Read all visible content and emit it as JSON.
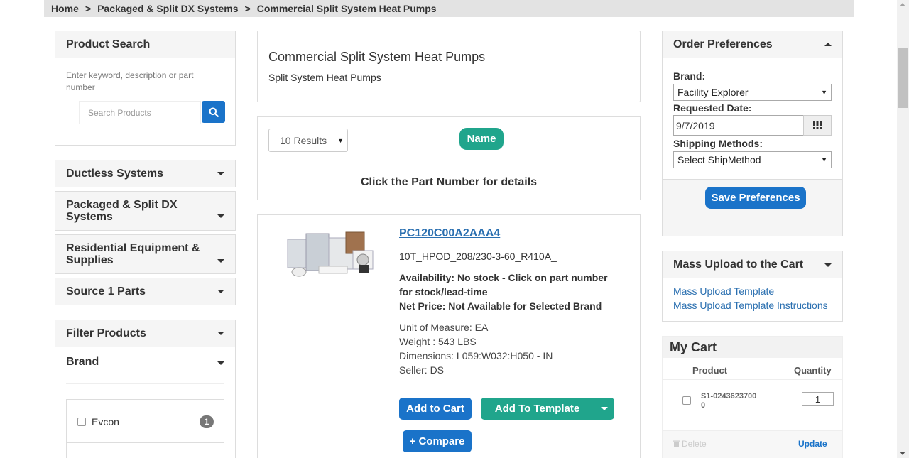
{
  "breadcrumb": {
    "items": [
      "Home",
      "Packaged & Split DX Systems",
      "Commercial Split System Heat Pumps"
    ],
    "separator": ">"
  },
  "product_search": {
    "title": "Product Search",
    "hint": "Enter keyword, description or part number",
    "placeholder": "Search Products",
    "search_icon": "search-icon"
  },
  "categories": [
    {
      "label": "Ductless Systems"
    },
    {
      "label": "Packaged & Split DX Systems"
    },
    {
      "label": "Residential Equipment & Supplies"
    },
    {
      "label": "Source 1 Parts"
    }
  ],
  "filter": {
    "title": "Filter Products",
    "brand_title": "Brand",
    "brands": [
      {
        "label": "Evcon",
        "count": "1"
      }
    ]
  },
  "category_header": {
    "title": "Commercial Split System Heat Pumps",
    "subtitle": "Split System Heat Pumps"
  },
  "results_bar": {
    "results_select": "10 Results",
    "sort_label": "Name",
    "instruction": "Click the Part Number for details"
  },
  "product": {
    "part_number": "PC120C00A2AAA4",
    "description": "10T_HPOD_208/230-3-60_R410A_",
    "availability": "Availability: No stock - Click on part number for stock/lead-time",
    "net_price": "Net Price: Not Available for Selected Brand",
    "unit_of_measure": "Unit of Measure: EA",
    "weight": "Weight : 543 LBS",
    "dimensions": "Dimensions: L059:W032:H050 - IN",
    "seller": "Seller: DS",
    "add_to_cart": "Add to Cart",
    "add_to_template": "Add To Template",
    "compare": "+ Compare"
  },
  "order_preferences": {
    "title": "Order Preferences",
    "brand_label": "Brand:",
    "brand_value": "Facility Explorer",
    "date_label": "Requested Date:",
    "date_value": "9/7/2019",
    "shipping_label": "Shipping Methods:",
    "shipping_value": "Select ShipMethod",
    "save": "Save Preferences"
  },
  "mass_upload": {
    "title": "Mass Upload to the Cart",
    "link1": "Mass Upload Template",
    "link2": "Mass Upload Template Instructions"
  },
  "cart": {
    "title": "My Cart",
    "col_product": "Product",
    "col_quantity": "Quantity",
    "items": [
      {
        "sku": "S1-02436237000",
        "qty": "1"
      }
    ],
    "delete": "Delete",
    "update": "Update"
  },
  "colors": {
    "primary": "#1a73c9",
    "teal": "#20a58c",
    "link": "#2a6fb0"
  }
}
